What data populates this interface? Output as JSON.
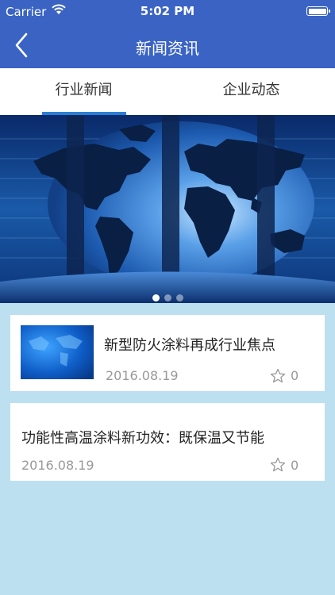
{
  "status_bar": {
    "carrier": "Carrier",
    "time": "5:02 PM"
  },
  "nav": {
    "title": "新闻资讯"
  },
  "tabs": [
    {
      "label": "行业新闻",
      "active": true
    },
    {
      "label": "企业动态",
      "active": false
    }
  ],
  "banner": {
    "slide_count": 3,
    "active_index": 0
  },
  "news": [
    {
      "title": "新型防火涂料再成行业焦点",
      "date": "2016.08.19",
      "likes": "0",
      "has_image": true
    },
    {
      "title": "功能性高温涂料新功效：既保温又节能",
      "date": "2016.08.19",
      "likes": "0",
      "has_image": false
    }
  ],
  "colors": {
    "nav_bg": "#3a63c4",
    "tab_indicator": "#2a7fd4",
    "page_bg": "#bde0f0"
  }
}
